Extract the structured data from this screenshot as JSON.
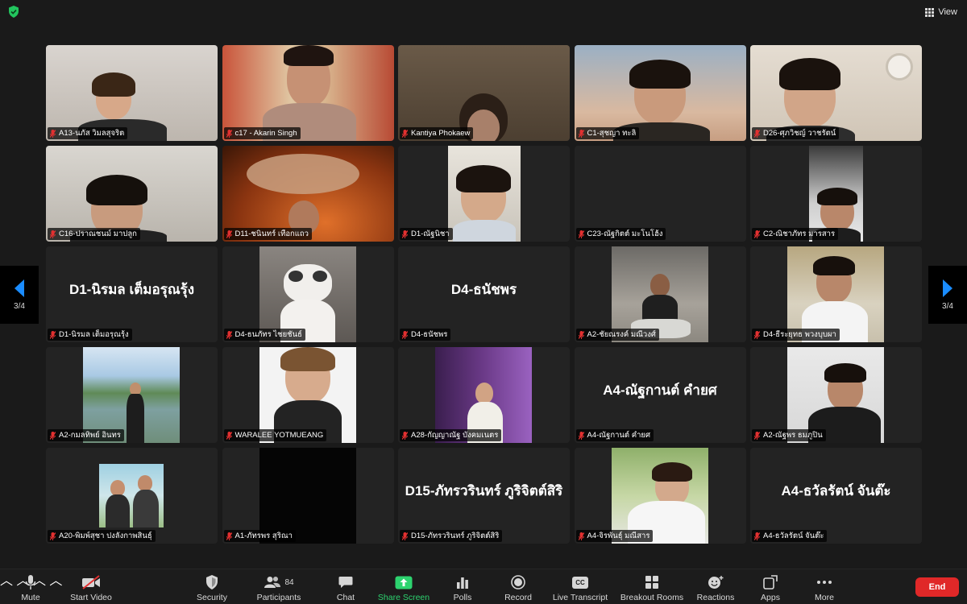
{
  "topbar": {
    "view_label": "View"
  },
  "pager": {
    "left": "3/4",
    "right": "3/4"
  },
  "tiles": [
    {
      "name": "A13-นภัส วิมลสุจริต"
    },
    {
      "name": "c17 - Akarin Singh"
    },
    {
      "name": "Kantiya Phokaew"
    },
    {
      "name": "C1-สุชญา ทะลิ"
    },
    {
      "name": "D26-ศุภวิชญ์ วาชรัตน์"
    },
    {
      "name": "C16-ปราณชนม์ มาปลูก"
    },
    {
      "name": "D11-ชนินทร์ เทือกแถว"
    },
    {
      "name": "D1-ณัฐนิชา"
    },
    {
      "name": "C23-ณัฐกิตต์ มะโนโฮ้ง"
    },
    {
      "name": "C2-ณิชาภัทร มารสาร"
    },
    {
      "name": "D1-นิรมล เต็มอรุณรุ้ง",
      "display": "D1-นิรมล เต็มอรุณรุ้ง"
    },
    {
      "name": "D4-ธนภัทร ไชยชันธ์"
    },
    {
      "name": "D4-ธนัชพร",
      "display": "D4-ธนัชพร"
    },
    {
      "name": "A2-ชัยณรงค์ มณีวงศ์"
    },
    {
      "name": "D4-ธีระยุทธ พวงบุบผา"
    },
    {
      "name": "A2-กมลทิพย์ อินทร"
    },
    {
      "name": "WARALEE YOTMUEANG"
    },
    {
      "name": "A28-กัญญาณัฐ บังคมเนตร"
    },
    {
      "name": "A4-ณัฐกานต์ คำยศ",
      "display": "A4-ณัฐกานต์ คำยศ"
    },
    {
      "name": "A2-ณัฐพร ธมภูปิน"
    },
    {
      "name": "A20-พิมพ์สุชา ปงลังกาพสินธุ์"
    },
    {
      "name": "A1-ภัทรพร สุริณา"
    },
    {
      "name": "D15-ภัทรวรินทร์ ภูริจิตต์สิริ",
      "display": "D15-ภัทรวรินทร์ ภูริจิตต์สิริ"
    },
    {
      "name": "A4-จิรพันธุ์ มณีสาร"
    },
    {
      "name": "A4-ธวัลรัตน์ จันต๊ะ",
      "display": "A4-ธวัลรัตน์ จันต๊ะ"
    }
  ],
  "toolbar": {
    "mute": "Mute",
    "start_video": "Start Video",
    "security": "Security",
    "participants": "Participants",
    "participants_count": "84",
    "chat": "Chat",
    "share_screen": "Share Screen",
    "polls": "Polls",
    "record": "Record",
    "live_transcript": "Live Transcript",
    "breakout_rooms": "Breakout Rooms",
    "reactions": "Reactions",
    "apps": "Apps",
    "more": "More",
    "end": "End",
    "cc_glyph": "CC"
  },
  "colors": {
    "accent_green": "#2dd36f",
    "end_red": "#e02828",
    "arrow_blue": "#1a8cff",
    "mic_red": "#e23030"
  }
}
